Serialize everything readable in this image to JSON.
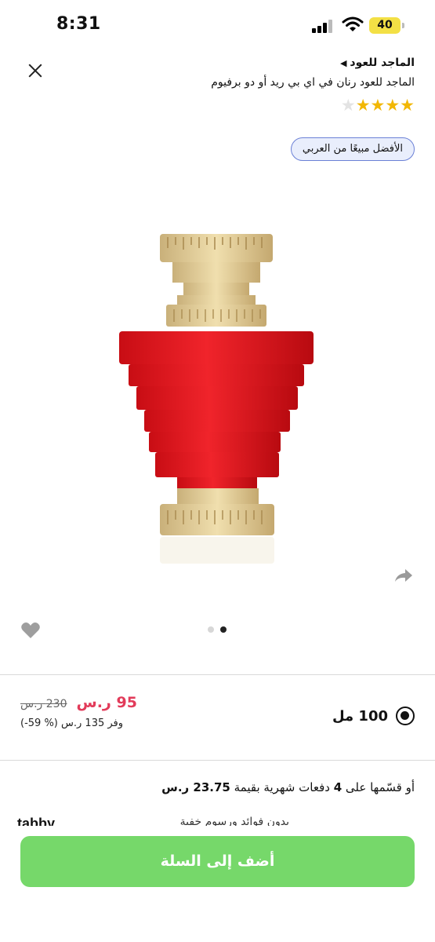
{
  "status_bar": {
    "time": "8:31",
    "battery": "40",
    "icons": [
      "signal-icon",
      "wifi-icon",
      "battery-icon"
    ]
  },
  "header": {
    "close_icon": "close-icon",
    "brand": "الماجد للعود",
    "brand_arrow": "◀",
    "title": "الماجد للعود رنان في اي بي ريد أو دو برفيوم",
    "rating": 4,
    "rating_max": 5
  },
  "badge": {
    "label": "الأفضل مبيعًا من العربي"
  },
  "gallery": {
    "image_count": 2,
    "active_index": 1,
    "share_icon": "share-icon",
    "favorite_icon": "heart-icon"
  },
  "variant": {
    "label": "100 مل",
    "selected": true
  },
  "price": {
    "current": "95 ر.س",
    "original": "230 ر.س",
    "savings": "وفر 135 ر.س (% 59-)"
  },
  "installment": {
    "prefix": "أو قسّمها على",
    "count": "4",
    "middle": "دفعات شهرية بقيمة",
    "amount": "23.75 ر.س",
    "provider": "tabby",
    "note": "بدون فوائد ورسوم خفية"
  },
  "cta": {
    "label": "أضف إلى السلة"
  },
  "colors": {
    "accent_green": "#76d86a",
    "price_red": "#e23b5a",
    "star_gold": "#f2b705",
    "badge_border": "#6b80d6"
  }
}
